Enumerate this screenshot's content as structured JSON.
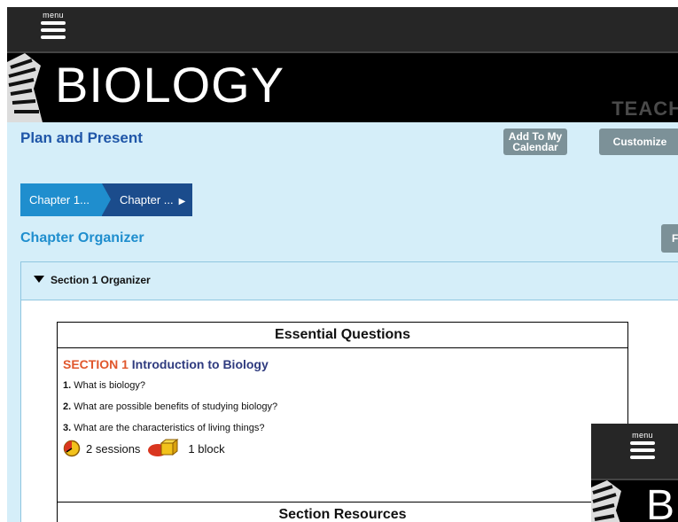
{
  "header": {
    "menu_label": "menu"
  },
  "banner": {
    "title": "BIOLOGY",
    "edition": "TEACH"
  },
  "page": {
    "title": "Plan and Present"
  },
  "toolbar": {
    "calendar_label_line1": "Add To My",
    "calendar_label_line2": "Calendar",
    "customize_label": "Customize"
  },
  "breadcrumb": {
    "items": [
      {
        "label": "Chapter 1..."
      },
      {
        "label": "Chapter ..."
      }
    ]
  },
  "organizer": {
    "title": "Chapter Organizer",
    "side_button_label": "F"
  },
  "section_panel": {
    "title": "Section 1 Organizer"
  },
  "essential": {
    "header": "Essential Questions",
    "section_num": "SECTION 1",
    "section_name": "Introduction to Biology",
    "questions": [
      {
        "num": "1.",
        "text": "What is biology?"
      },
      {
        "num": "2.",
        "text": "What are possible benefits of studying biology?"
      },
      {
        "num": "3.",
        "text": "What are the characteristics of living things?"
      }
    ],
    "sessions": "2 sessions",
    "blocks": "1 block",
    "resources_header": "Section Resources"
  },
  "overlay": {
    "menu_label": "menu",
    "banner_letter": "B"
  },
  "colors": {
    "accent_blue": "#1f8ece",
    "dark_blue": "#1b4c8c",
    "section_orange": "#e0572c",
    "gray_button": "#7c9198"
  }
}
